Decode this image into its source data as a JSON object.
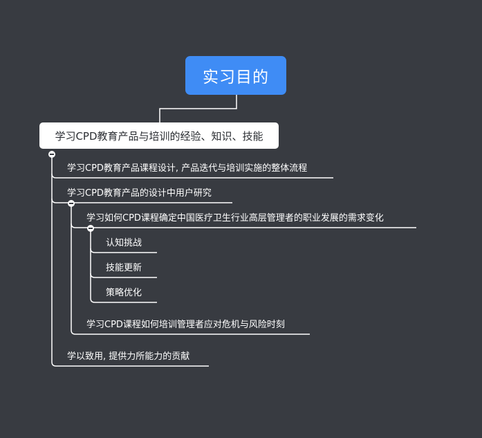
{
  "root": {
    "label": "实习目的"
  },
  "main_topic": {
    "label": "学习CPD教育产品与培训的经验、知识、技能"
  },
  "children": [
    {
      "label": "学习CPD教育产品课程设计, 产品迭代与培训实施的整体流程"
    },
    {
      "label": "学习CPD教育产品的设计中用户研究",
      "children": [
        {
          "label": "学习如何CPD课程确定中国医疗卫生行业高层管理者的职业发展的需求变化",
          "children": [
            {
              "label": "认知挑战"
            },
            {
              "label": "技能更新"
            },
            {
              "label": "策略优化"
            }
          ]
        },
        {
          "label": "学习CPD课程如何培训管理者应对危机与风险时刻"
        }
      ]
    },
    {
      "label": "学以致用, 提供力所能力的贡献"
    }
  ],
  "colors": {
    "background": "#383b41",
    "root_fill": "#3f8cf5",
    "topic_fill": "#ffffff",
    "line": "#ffffff"
  }
}
